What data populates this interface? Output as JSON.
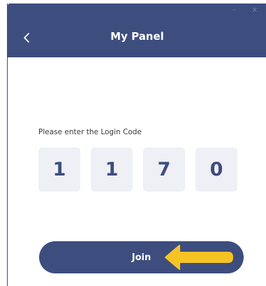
{
  "window": {
    "title": "My Panel",
    "controls": "– x",
    "back_icon": "chevron-left-icon"
  },
  "login": {
    "prompt": "Please enter the Login Code",
    "digits": [
      "1",
      "1",
      "7",
      "0"
    ],
    "join_label": "Join"
  },
  "annotation": {
    "arrow_icon": "arrow-left-icon",
    "arrow_color": "#f6c324"
  },
  "colors": {
    "accent": "#3d4e7e",
    "code_box_bg": "#eef0f5"
  }
}
